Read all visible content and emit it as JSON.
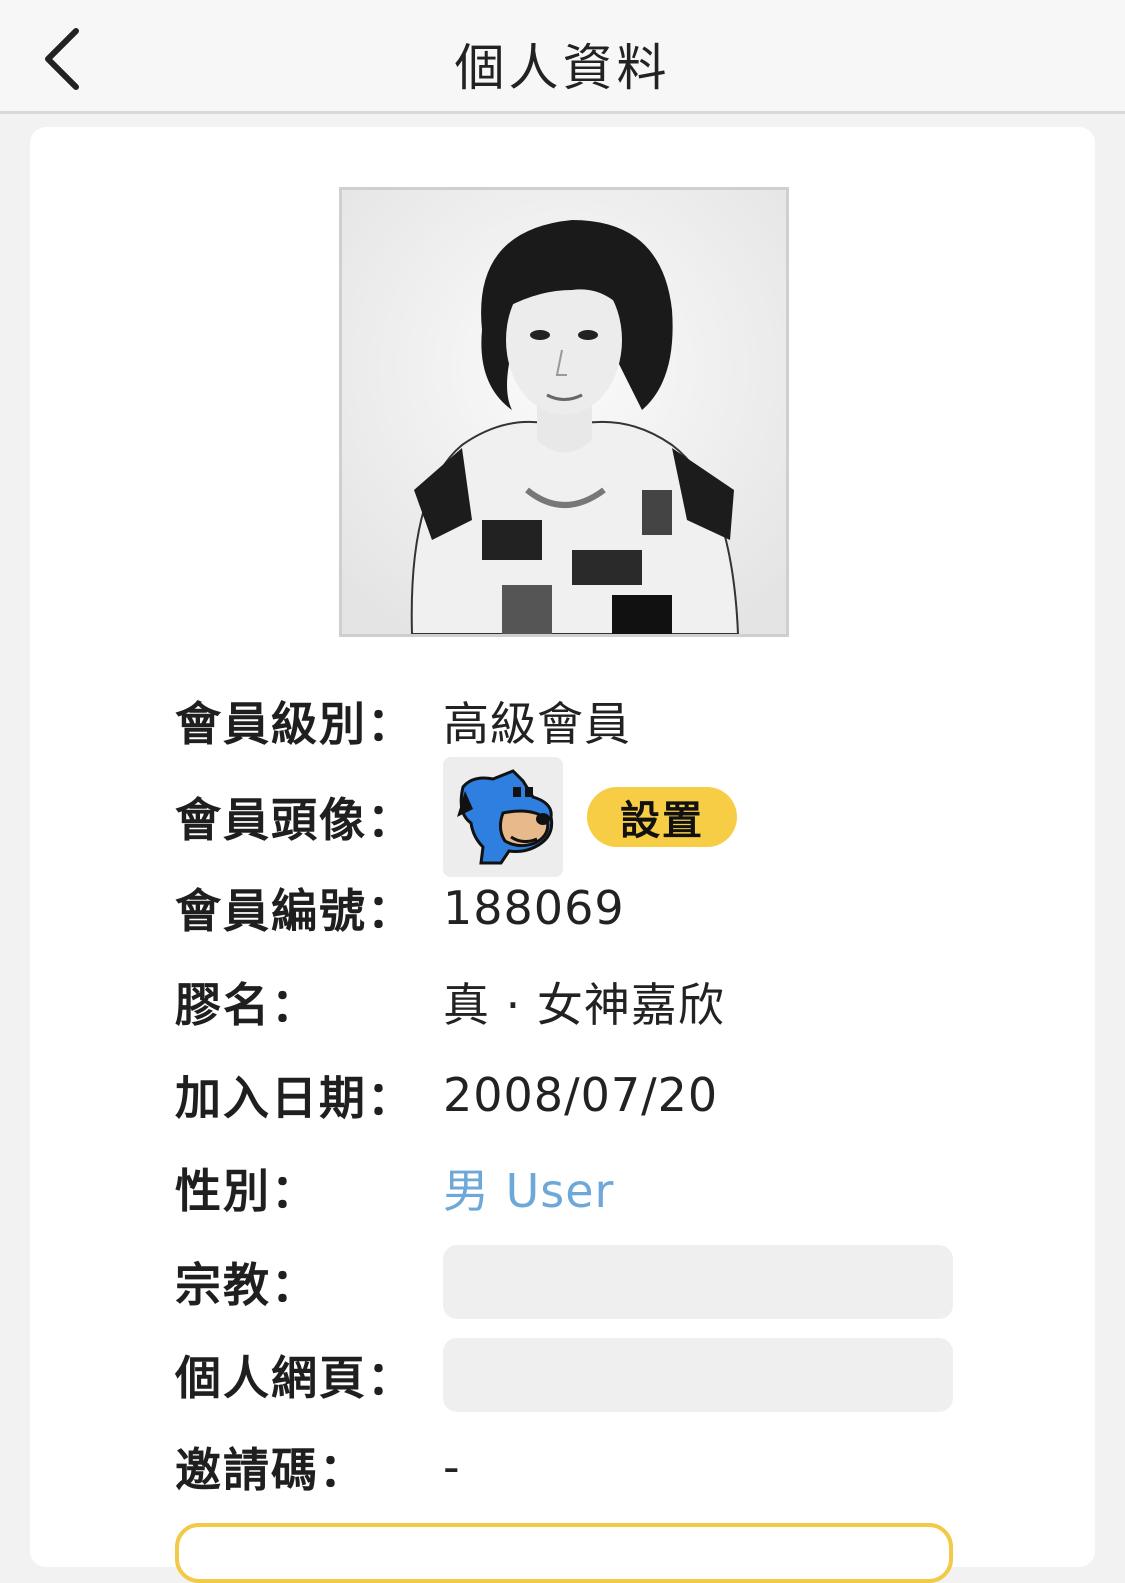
{
  "header": {
    "title": "個人資料"
  },
  "profile": {
    "rows": [
      {
        "label": "會員級別：",
        "value": "高級會員"
      },
      {
        "label": "會員頭像：",
        "button": "設置"
      },
      {
        "label": "會員編號：",
        "value": "188069"
      },
      {
        "label": "膠名：",
        "value": "真 · 女神嘉欣"
      },
      {
        "label": "加入日期：",
        "value": "2008/07/20"
      },
      {
        "label": "性別：",
        "value": "男 User"
      },
      {
        "label": "宗教：",
        "value": ""
      },
      {
        "label": "個人網頁：",
        "value": ""
      },
      {
        "label": "邀請碼：",
        "value": "-"
      }
    ]
  },
  "colors": {
    "accent_yellow": "#f7cd46",
    "link_blue": "#6ea8d8"
  },
  "icons": {
    "back": "chevron-left-icon",
    "avatar": "cartoon-dog-avatar"
  }
}
